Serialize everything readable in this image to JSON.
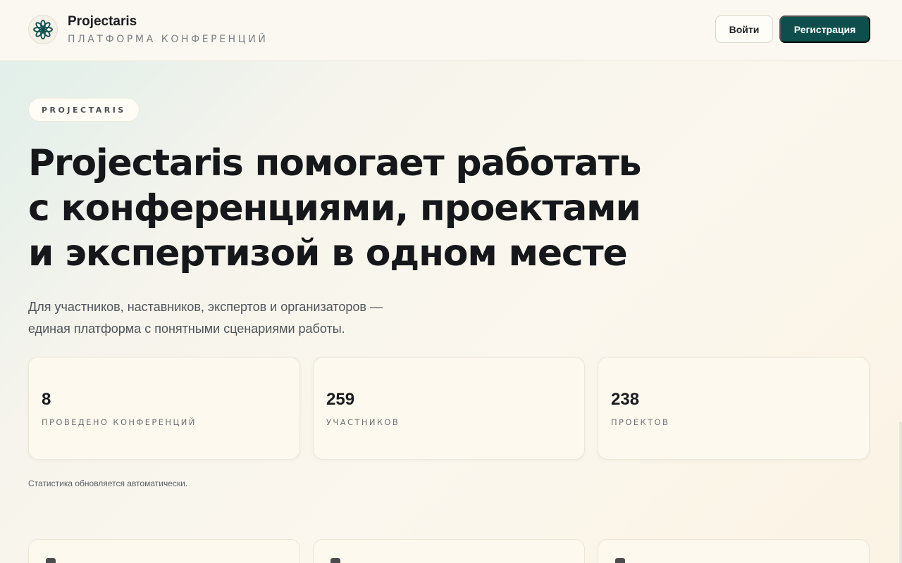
{
  "header": {
    "brand_name": "Projectaris",
    "brand_subtitle": "ПЛАТФОРМА КОНФЕРЕНЦИЙ",
    "logo_icon": "flower-icon",
    "login_label": "Войти",
    "register_label": "Регистрация"
  },
  "colors": {
    "accent": "#0e4f4e",
    "background": "#fbf7ee",
    "card": "#fdf9ee"
  },
  "hero": {
    "pill": "PROJECTARIS",
    "title_lines": [
      "Projectaris помогает работать",
      "с конференциями, проектами",
      "и экспертизой в одном месте"
    ],
    "description_lines": [
      "Для участников, наставников, экспертов и организаторов —",
      "единая платформа с понятными сценариями работы."
    ]
  },
  "stats": [
    {
      "value": "8",
      "label": "ПРОВЕДЕНО КОНФЕРЕНЦИЙ"
    },
    {
      "value": "259",
      "label": "УЧАСТНИКОВ"
    },
    {
      "value": "238",
      "label": "ПРОЕКТОВ"
    }
  ],
  "stats_note": "Статистика обновляется автоматически."
}
